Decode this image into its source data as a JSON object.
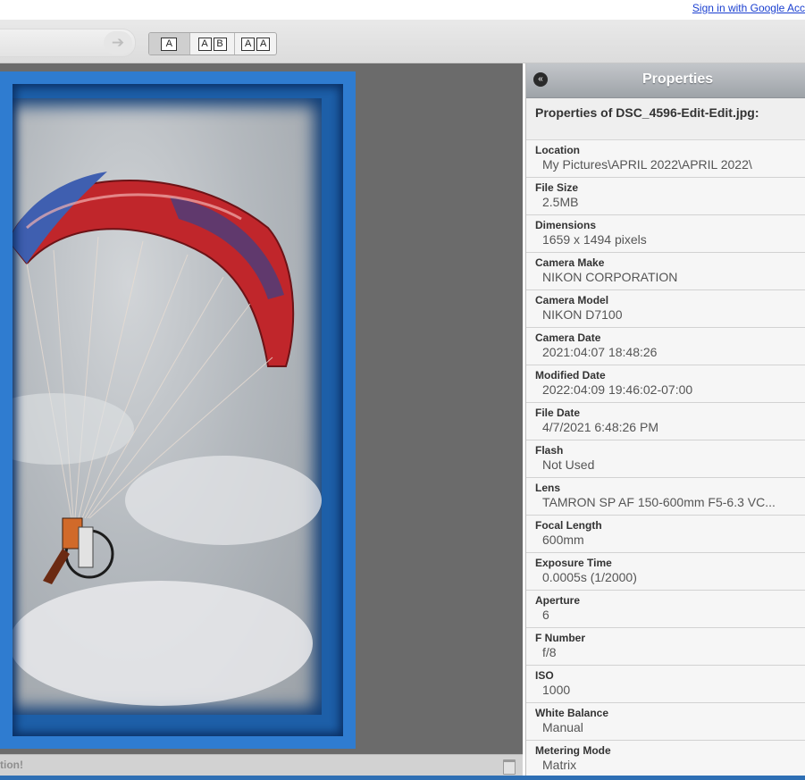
{
  "header": {
    "signin_link": "Sign in with Google Acc"
  },
  "toolbar": {
    "forward_icon": "arrow-right-icon",
    "view_modes": [
      {
        "letters": [
          "A"
        ]
      },
      {
        "letters": [
          "A",
          "B"
        ]
      },
      {
        "letters": [
          "A",
          "A"
        ]
      }
    ]
  },
  "viewer": {
    "status_text": "tion!"
  },
  "panel": {
    "title": "Properties",
    "collapse_icon": "double-chevron-left-icon",
    "file_heading": "Properties of DSC_4596-Edit-Edit.jpg:",
    "properties": [
      {
        "label": "Location",
        "value": "My Pictures\\APRIL 2022\\APRIL 2022\\"
      },
      {
        "label": "File Size",
        "value": "2.5MB"
      },
      {
        "label": "Dimensions",
        "value": "1659 x 1494 pixels"
      },
      {
        "label": "Camera Make",
        "value": "NIKON CORPORATION"
      },
      {
        "label": "Camera Model",
        "value": "NIKON D7100"
      },
      {
        "label": "Camera Date",
        "value": "2021:04:07 18:48:26"
      },
      {
        "label": "Modified Date",
        "value": "2022:04:09 19:46:02-07:00"
      },
      {
        "label": "File Date",
        "value": "4/7/2021 6:48:26 PM"
      },
      {
        "label": "Flash",
        "value": "Not Used"
      },
      {
        "label": "Lens",
        "value": "TAMRON SP AF 150-600mm F5-6.3 VC..."
      },
      {
        "label": "Focal Length",
        "value": "600mm"
      },
      {
        "label": "Exposure Time",
        "value": "0.0005s (1/2000)"
      },
      {
        "label": "Aperture",
        "value": "6"
      },
      {
        "label": "F Number",
        "value": "f/8"
      },
      {
        "label": "ISO",
        "value": "1000"
      },
      {
        "label": "White Balance",
        "value": "Manual"
      },
      {
        "label": "Metering Mode",
        "value": "Matrix"
      }
    ]
  },
  "colors": {
    "accent": "#2e6fb4",
    "frame": "#1d5fa8",
    "canopy": "#c0262b"
  }
}
